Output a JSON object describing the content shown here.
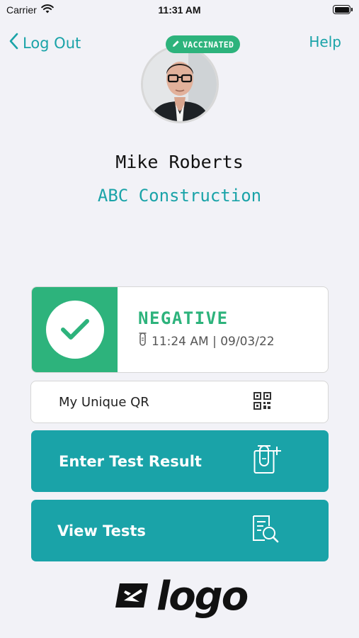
{
  "status_bar": {
    "carrier": "Carrier",
    "time": "11:31 AM"
  },
  "nav": {
    "back_label": "Log Out",
    "help_label": "Help"
  },
  "profile": {
    "badge": "VACCINATED",
    "name": "Mike Roberts",
    "company": "ABC Construction"
  },
  "result": {
    "status": "NEGATIVE",
    "timestamp": "11:24 AM | 09/03/22",
    "status_color": "#2db37c"
  },
  "qr": {
    "label": "My Unique QR"
  },
  "actions": {
    "enter_test": "Enter Test Result",
    "view_tests": "View Tests"
  },
  "logo": {
    "text": "logo"
  },
  "colors": {
    "accent": "#1aa3a8",
    "success": "#2db37c",
    "background": "#f2f2f7"
  },
  "icons": [
    "wifi-icon",
    "battery-icon",
    "chevron-left-icon",
    "pencil-icon",
    "checkmark-icon",
    "test-tube-icon",
    "qr-code-icon",
    "test-tube-plus-icon",
    "document-search-icon",
    "logo-plane-icon"
  ]
}
